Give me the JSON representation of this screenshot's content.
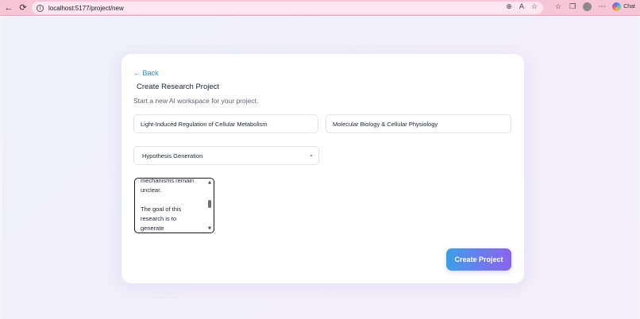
{
  "browser": {
    "url": "localhost:5177/project/new",
    "chat_label": "Chat",
    "back_icon": "←",
    "refresh_icon": "⟳",
    "menu_icon": "⋯"
  },
  "page": {
    "back_link": "← Back",
    "title": "Create Research Project",
    "subtitle": "Start a new AI workspace for your project.",
    "project_title_value": "Light-Induced Regulation of Cellular Metabolism",
    "domain_value": "Molecular Biology & Cellular Physiology",
    "task_type_value": "Hypothesis Generation",
    "description_value": "mechanisms remain\nunclear.\n\nThe goal of this\nresearch is to\ngenerate",
    "create_button": "Create Project"
  },
  "colors": {
    "chrome_pink": "#f6c6d6",
    "link_blue": "#2a8fb8",
    "button_gradient_start": "#3c9fe6",
    "button_gradient_end": "#8a64ef"
  }
}
